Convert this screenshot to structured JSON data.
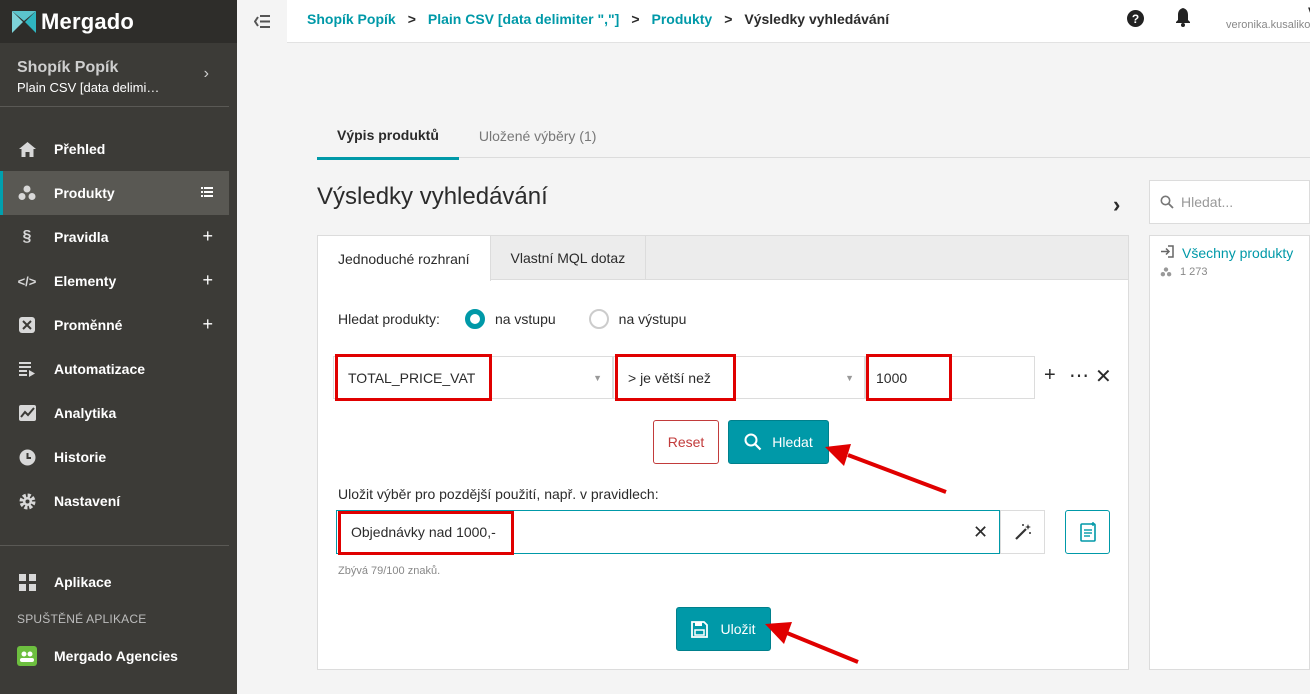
{
  "app": {
    "logo": "Mergado"
  },
  "shop": {
    "name": "Shopík Popík",
    "feed": "Plain CSV [data delimi…"
  },
  "nav": {
    "items": [
      {
        "label": "Přehled"
      },
      {
        "label": "Produkty"
      },
      {
        "label": "Pravidla"
      },
      {
        "label": "Elementy"
      },
      {
        "label": "Proměnné"
      },
      {
        "label": "Automatizace"
      },
      {
        "label": "Analytika"
      },
      {
        "label": "Historie"
      },
      {
        "label": "Nastavení"
      }
    ],
    "plus": "+",
    "apps_label": "Aplikace",
    "running_label": "SPUŠTĚNÉ APLIKACE",
    "running_app": "Mergado Agencies"
  },
  "breadcrumb": {
    "items": [
      "Shopík Popík",
      "Plain CSV [data delimiter \",\"]",
      "Produkty"
    ],
    "current": "Výsledky vyhledávání",
    "sep": ">"
  },
  "user": {
    "name": "Ve",
    "email": "veronika.kusalikova"
  },
  "tabs": {
    "active": "Výpis produktů",
    "saved": "Uložené výběry (1)"
  },
  "page": {
    "title": "Výsledky vyhledávání"
  },
  "panel": {
    "tabs": {
      "simple": "Jednoduché rozhraní",
      "mql": "Vlastní MQL dotaz"
    },
    "search_label": "Hledat produkty:",
    "radio_in": "na vstupu",
    "radio_out": "na výstupu",
    "field": "TOTAL_PRICE_VAT",
    "operator": "> je větší než",
    "value": "1000",
    "reset": "Reset",
    "search": "Hledat",
    "save_label": "Uložit výběr pro pozdější použití, např. v pravidlech:",
    "save_value": "Objednávky nad 1000,-",
    "hint": "Zbývá 79/100 znaků.",
    "save": "Uložit"
  },
  "right": {
    "search_placeholder": "Hledat...",
    "all": "Všechny produkty",
    "count": "1 273"
  },
  "colors": {
    "accent": "#0099a8",
    "sidebar": "#3c3b37",
    "highlight": "#e00000"
  }
}
